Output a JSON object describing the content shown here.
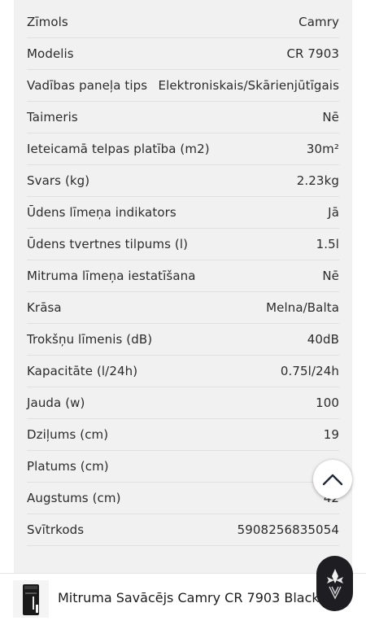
{
  "specs": [
    {
      "label": "Zīmols",
      "value": "Camry"
    },
    {
      "label": "Modelis",
      "value": "CR 7903"
    },
    {
      "label": "Vadības paneļa tips",
      "value": "Elektroniskais/Skārienjūtīgais"
    },
    {
      "label": "Taimeris",
      "value": "Nē"
    },
    {
      "label": "Ieteicamā telpas platība (m2)",
      "value": "30m²"
    },
    {
      "label": "Svars (kg)",
      "value": "2.23kg"
    },
    {
      "label": "Ūdens līmeņa indikators",
      "value": "Jā"
    },
    {
      "label": "Ūdens tvertnes tilpums (l)",
      "value": "1.5l"
    },
    {
      "label": "Mitruma līmeņa iestatīšana",
      "value": "Nē"
    },
    {
      "label": "Krāsa",
      "value": "Melna/Balta"
    },
    {
      "label": "Trokšņu līmenis (dB)",
      "value": "40dB"
    },
    {
      "label": "Kapacitāte (l/24h)",
      "value": "0.75l/24h"
    },
    {
      "label": "Jauda (w)",
      "value": "100"
    },
    {
      "label": "Dziļums (cm)",
      "value": "19"
    },
    {
      "label": "Platums (cm)",
      "value": ""
    },
    {
      "label": "Augstums (cm)",
      "value": "42"
    },
    {
      "label": "Svītrkods",
      "value": "5908256835054"
    }
  ],
  "sticky_bar": {
    "product_title": "Mitruma Savācējs Camry CR 7903 Black/W"
  },
  "icons": {
    "scroll_top": "chevron-up-icon",
    "chat": "chat-widget-icon"
  }
}
